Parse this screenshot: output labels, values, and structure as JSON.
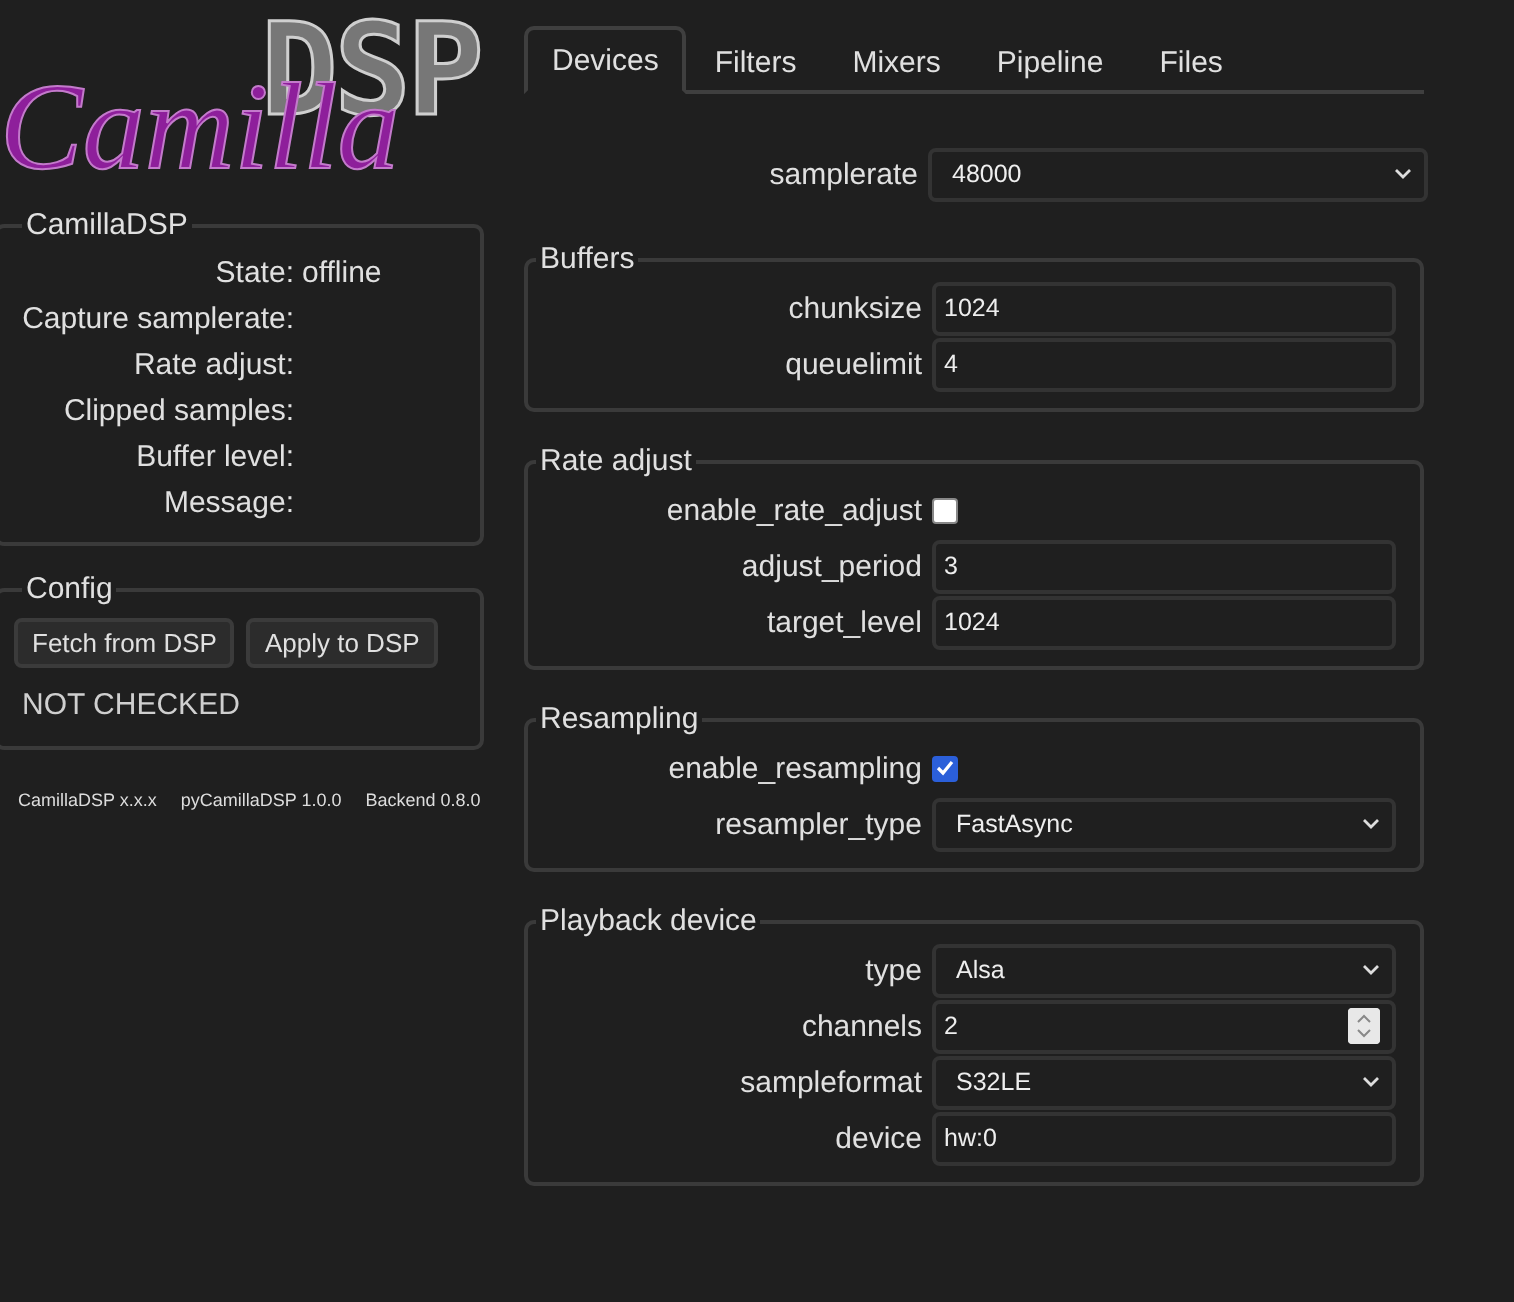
{
  "logo": {
    "script": "Camilla",
    "blocks": "DSP"
  },
  "status_panel": {
    "title": "CamillaDSP",
    "rows": [
      {
        "label": "State:",
        "value": "offline"
      },
      {
        "label": "Capture samplerate:"
      },
      {
        "label": "Rate adjust:"
      },
      {
        "label": "Clipped samples:"
      },
      {
        "label": "Buffer level:"
      },
      {
        "label": "Message:"
      }
    ]
  },
  "config_panel": {
    "title": "Config",
    "buttons": [
      "Fetch from DSP",
      "Apply to DSP"
    ],
    "status": "NOT CHECKED"
  },
  "versions": [
    "CamillaDSP x.x.x",
    "pyCamillaDSP 1.0.0",
    "Backend 0.8.0"
  ],
  "tabs": [
    {
      "label": "Devices",
      "selected": true
    },
    {
      "label": "Filters",
      "selected": false
    },
    {
      "label": "Mixers",
      "selected": false
    },
    {
      "label": "Pipeline",
      "selected": false
    },
    {
      "label": "Files",
      "selected": false
    }
  ],
  "top_fields": [
    {
      "kind": "select",
      "label": "samplerate",
      "value": "48000"
    }
  ],
  "groups": [
    {
      "title": "Buffers",
      "fields": [
        {
          "kind": "text",
          "label": "chunksize",
          "value": "1024"
        },
        {
          "kind": "text",
          "label": "queuelimit",
          "value": "4"
        }
      ]
    },
    {
      "title": "Rate adjust",
      "fields": [
        {
          "kind": "checkbox",
          "label": "enable_rate_adjust",
          "checked": false
        },
        {
          "kind": "text",
          "label": "adjust_period",
          "value": "3"
        },
        {
          "kind": "text",
          "label": "target_level",
          "value": "1024"
        }
      ]
    },
    {
      "title": "Resampling",
      "fields": [
        {
          "kind": "checkbox",
          "label": "enable_resampling",
          "checked": true
        },
        {
          "kind": "select",
          "label": "resampler_type",
          "value": "FastAsync"
        }
      ]
    },
    {
      "title": "Playback device",
      "fields": [
        {
          "kind": "select",
          "label": "type",
          "value": "Alsa"
        },
        {
          "kind": "number",
          "label": "channels",
          "value": "2"
        },
        {
          "kind": "select",
          "label": "sampleformat",
          "value": "S32LE"
        },
        {
          "kind": "text",
          "label": "device",
          "value": "hw:0"
        }
      ]
    }
  ]
}
